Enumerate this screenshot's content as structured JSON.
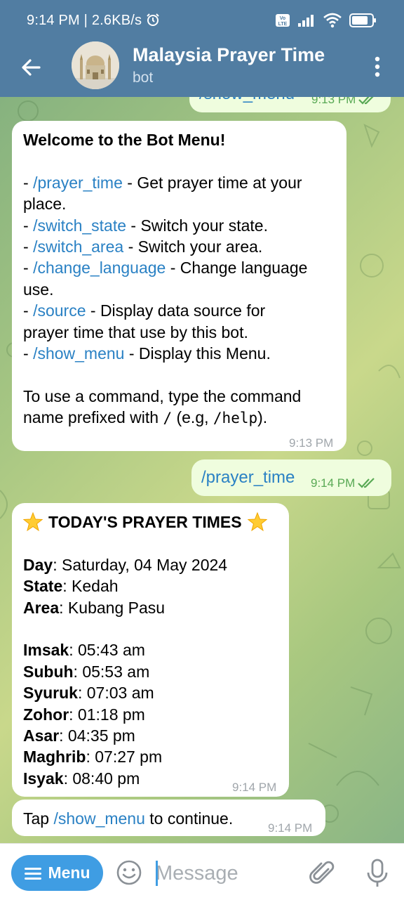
{
  "status_bar": {
    "time": "9:14 PM",
    "speed": "2.6KB/s",
    "volte": "Vo LTE"
  },
  "header": {
    "title": "Malaysia Prayer Time",
    "subtitle": "bot"
  },
  "messages": {
    "m0": {
      "text": "/show_menu",
      "time": "9:13 PM"
    },
    "m1": {
      "heading": "Welcome to the Bot Menu!",
      "items": [
        {
          "dash": "- ",
          "cmd": "/prayer_time",
          "desc": " - Get prayer time at your",
          "desc2": "place."
        },
        {
          "dash": "- ",
          "cmd": "/switch_state",
          "desc": " - Switch your state."
        },
        {
          "dash": "- ",
          "cmd": "/switch_area",
          "desc": " - Switch your area."
        },
        {
          "dash": "- ",
          "cmd": "/change_language",
          "desc": " - Change language",
          "desc2": "use."
        },
        {
          "dash": "- ",
          "cmd": "/source",
          "desc": " - Display data source for",
          "desc2": "prayer time that use by this bot."
        },
        {
          "dash": "- ",
          "cmd": "/show_menu",
          "desc": " - Display this Menu."
        }
      ],
      "footer_line1": "To use a command, type the command",
      "footer_line2_pre": "name prefixed with ",
      "footer_slash": "/",
      "footer_mid": " (e.g, ",
      "footer_help": "/help",
      "footer_end": ").",
      "time": "9:13 PM"
    },
    "m2": {
      "text": "/prayer_time",
      "time": "9:14 PM"
    },
    "m3": {
      "heading": "TODAY'S PRAYER TIMES",
      "info": [
        {
          "label": "Day",
          "value": ": Saturday, 04 May 2024"
        },
        {
          "label": "State",
          "value": ": Kedah"
        },
        {
          "label": "Area",
          "value": ": Kubang Pasu"
        }
      ],
      "times": [
        {
          "label": "Imsak",
          "value": ": 05:43 am"
        },
        {
          "label": "Subuh",
          "value": ": 05:53 am"
        },
        {
          "label": "Syuruk",
          "value": ": 07:03 am"
        },
        {
          "label": "Zohor",
          "value": ": 01:18 pm"
        },
        {
          "label": "Asar",
          "value": ": 04:35 pm"
        },
        {
          "label": "Maghrib",
          "value": ": 07:27 pm"
        },
        {
          "label": "Isyak",
          "value": ": 08:40 pm"
        }
      ],
      "time": "9:14 PM"
    },
    "m4": {
      "pre": "Tap ",
      "cmd": "/show_menu",
      "post": " to continue.",
      "time": "9:14 PM"
    }
  },
  "input": {
    "menu_label": "Menu",
    "placeholder": "Message"
  },
  "colors": {
    "header": "#517da2",
    "link": "#2a81c4",
    "outgoing_bubble": "#effdde",
    "menu_button": "#3f9de3"
  },
  "icons": [
    "back-arrow-icon",
    "more-vert-icon",
    "alarm-icon",
    "signal-icon",
    "wifi-icon",
    "battery-icon",
    "double-check-icon",
    "star-emoji-icon",
    "hamburger-icon",
    "emoji-icon",
    "paperclip-icon",
    "microphone-icon"
  ]
}
